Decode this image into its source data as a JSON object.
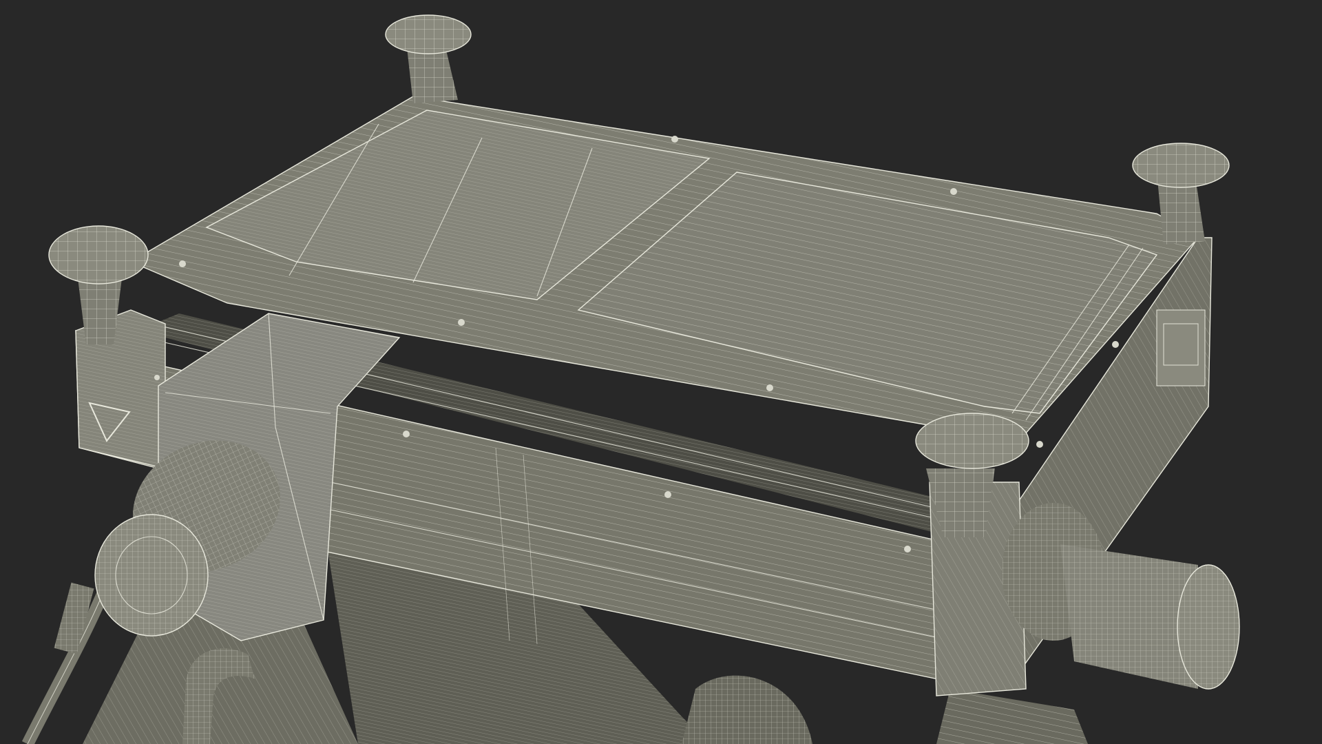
{
  "scene": {
    "subject": "wireframe-render",
    "background_color": "#282828",
    "model_fill_color": "#7a7a6e",
    "model_shadow_color": "#5f5f55",
    "model_light_color": "#8a8a7e",
    "wire_color": "#e8e8dc",
    "marking": "triangle-down"
  }
}
